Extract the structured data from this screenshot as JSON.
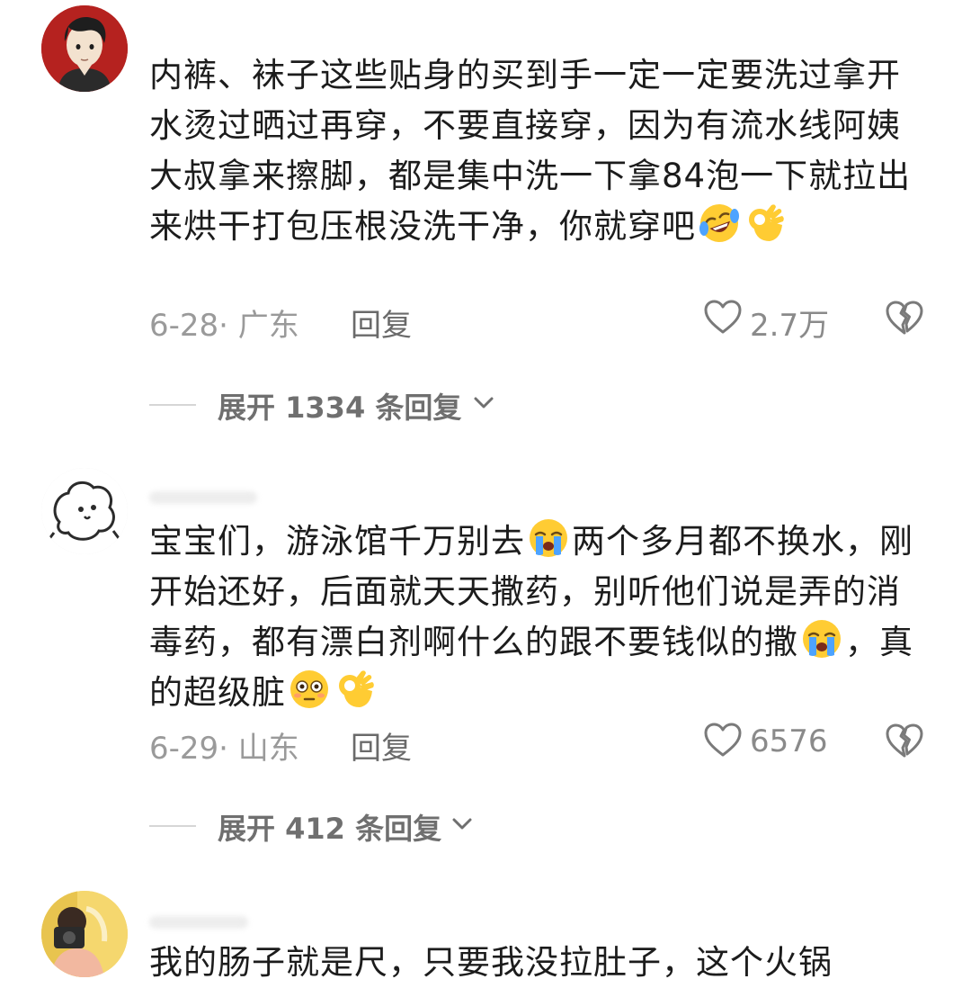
{
  "comments": [
    {
      "text": "内裤、袜子这些贴身的买到手一定一定要洗过拿开水烫过晒过再穿，不要直接穿，因为有流水线阿姨大叔拿来擦脚，都是集中洗一下拿84泡一下就拉出来烘干打包压根没洗干净，你就穿吧",
      "emojis": [
        "rofl-emoji",
        "ok-hand-emoji"
      ],
      "date": "6-28",
      "location": "广东",
      "reply_label": "回复",
      "likes": "2.7万",
      "expand_label": "展开 1334 条回复"
    },
    {
      "text_parts": [
        "宝宝们，游泳馆千万别去",
        "两个多月都不换水，刚开始还好，后面就天天撒药，别听他们说是弄的消毒药，都有漂白剂啊什么的跟不要钱似的撒",
        "，真的超级脏"
      ],
      "date": "6-29",
      "location": "山东",
      "reply_label": "回复",
      "likes": "6576",
      "expand_label": "展开 412 条回复"
    },
    {
      "text": "我的肠子就是尺，只要我没拉肚子，这个火锅"
    }
  ],
  "icons": {
    "like": "heart-outline-icon",
    "dislike": "broken-heart-icon",
    "expand": "chevron-down-icon"
  },
  "colors": {
    "meta_gray": "#9a9a9a",
    "text": "#1c1c1c",
    "emoji_yellow": "#ffcc33",
    "tear_blue": "#4da3ff"
  }
}
